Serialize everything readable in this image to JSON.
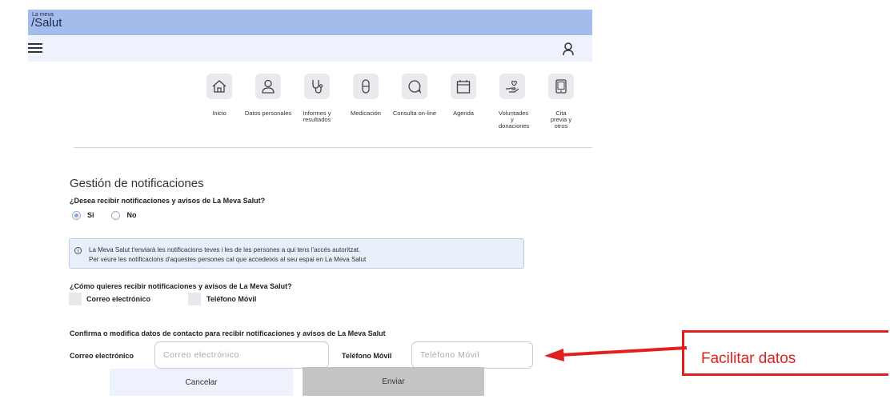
{
  "header": {
    "logo_small": "La meva",
    "logo_main": "/Salut"
  },
  "nav_tiles": [
    {
      "label": "Inicio",
      "icon": "home-icon"
    },
    {
      "label": "Datos personales",
      "icon": "person-icon"
    },
    {
      "label": "Informes y resultados",
      "icon": "stethoscope-icon"
    },
    {
      "label": "Medicación",
      "icon": "pill-icon"
    },
    {
      "label": "Consulta on-line",
      "icon": "chat-bubble-icon"
    },
    {
      "label": "Agenda",
      "icon": "calendar-icon"
    },
    {
      "label": "Voluntades y donaciones",
      "icon": "heart-hand-icon"
    },
    {
      "label": "Cita previa y otros",
      "icon": "tablet-icon"
    }
  ],
  "form": {
    "title": "Gestión de notificaciones",
    "question1": "¿Desea recibir notificaciones y avisos de La Meva Salut?",
    "option_yes": "Si",
    "option_no": "No",
    "info_line1": "La Meva Salut t'enviarà les notificacions teves i les de les persones a qui tens l'accés autoritzat.",
    "info_line2": "Per veure les notificacions d'aquestes persones cal que accedeixis al seu espai en La Meva Salut",
    "question2": "¿Cómo quieres recibir notificaciones y avisos de La Meva Salut?",
    "checkbox_email": "Correo electrónico",
    "checkbox_phone": "Teléfono Móvil",
    "confirm_heading": "Confirma o modifica datos de contacto para recibir notificaciones y avisos de La Meva Salut",
    "email_label": "Correo electrónico",
    "email_placeholder": "Correo electrónico",
    "phone_label": "Teléfono Móvil",
    "phone_placeholder": "Teléfono Móvil",
    "cancel_label": "Cancelar",
    "submit_label": "Enviar"
  },
  "annotation": {
    "text": "Facilitar datos",
    "color": "#e02020"
  },
  "colors": {
    "topbar": "#a4bcec",
    "navbar": "#edf2fc",
    "submit_bg": "#c4c4c6",
    "cancel_bg": "#edf2fc"
  }
}
